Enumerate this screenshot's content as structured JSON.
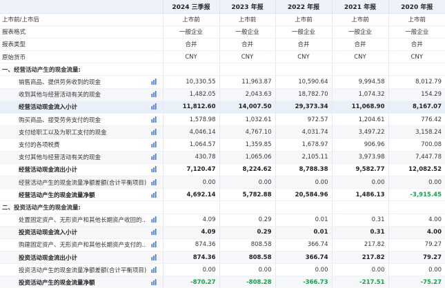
{
  "columns": [
    "2024 三季报",
    "2023 年报",
    "2022 年报",
    "2021 年报",
    "2020 年报"
  ],
  "rows": [
    {
      "type": "meta",
      "label": "上市前/上市后",
      "values": [
        "上市前",
        "上市前",
        "上市前",
        "上市前",
        "上市前"
      ]
    },
    {
      "type": "meta",
      "label": "报表格式",
      "values": [
        "一般企业",
        "一般企业",
        "一般企业",
        "一般企业",
        "一般企业"
      ]
    },
    {
      "type": "meta",
      "label": "报表类型",
      "values": [
        "合并",
        "合并",
        "合并",
        "合并",
        "合并"
      ]
    },
    {
      "type": "meta",
      "label": "原始货币",
      "values": [
        "CNY",
        "CNY",
        "CNY",
        "CNY",
        "CNY"
      ]
    },
    {
      "type": "section",
      "label": "一、经营活动产生的现金流量:",
      "values": [
        "",
        "",
        "",
        "",
        ""
      ]
    },
    {
      "type": "item",
      "label": "销售商品、提供劳务收到的现金",
      "values": [
        "10,330.55",
        "11,963.87",
        "10,590.64",
        "9,994.58",
        "8,012.79"
      ]
    },
    {
      "type": "item",
      "label": "收到其他与经营活动有关的现金",
      "values": [
        "1,482.05",
        "2,043.63",
        "18,782.70",
        "1,074.32",
        "154.29"
      ]
    },
    {
      "type": "subtotal",
      "label": "经营活动现金流入小计",
      "values": [
        "11,812.60",
        "14,007.50",
        "29,373.34",
        "11,068.90",
        "8,167.07"
      ]
    },
    {
      "type": "item",
      "label": "购买商品、接受劳务支付的现金",
      "values": [
        "1,578.98",
        "1,032.61",
        "972.57",
        "1,204.61",
        "776.42"
      ]
    },
    {
      "type": "item",
      "label": "支付给职工以及为职工支付的现金",
      "values": [
        "4,046.14",
        "4,767.10",
        "4,031.74",
        "3,497.22",
        "3,158.24"
      ]
    },
    {
      "type": "item",
      "label": "支付的各项税费",
      "values": [
        "1,064.57",
        "1,359.85",
        "1,678.97",
        "906.96",
        "700.08"
      ]
    },
    {
      "type": "item",
      "label": "支付其他与经营活动有关的现金",
      "values": [
        "430.78",
        "1,065.06",
        "2,105.11",
        "3,973.98",
        "7,447.78"
      ]
    },
    {
      "type": "bold",
      "label": "经营活动现金流出小计",
      "values": [
        "7,120.47",
        "8,224.62",
        "8,788.38",
        "9,582.77",
        "12,082.52"
      ]
    },
    {
      "type": "item",
      "label": "经营活动产生的现金流量净额差额(合计平衡项目)",
      "values": [
        "0.00",
        "0.00",
        "0.00",
        "0.00",
        "0.00"
      ]
    },
    {
      "type": "bold",
      "label": "经营活动产生的现金流量净额",
      "values": [
        "4,692.14",
        "5,782.88",
        "20,584.96",
        "1,486.13",
        "-3,915.45"
      ]
    },
    {
      "type": "section",
      "label": "二、投资活动产生的现金流量:",
      "values": [
        "",
        "",
        "",
        "",
        ""
      ]
    },
    {
      "type": "item",
      "label": "处置固定资产、无形资产和其他长期资产收回的...",
      "values": [
        "4.09",
        "0.29",
        "0.01",
        "0.31",
        "4.00"
      ]
    },
    {
      "type": "bold",
      "label": "投资活动现金流入小计",
      "values": [
        "4.09",
        "0.29",
        "0.01",
        "0.31",
        "4.00"
      ]
    },
    {
      "type": "item",
      "label": "购建固定资产、无形资产和其他长期资产支付的...",
      "values": [
        "874.36",
        "808.58",
        "366.74",
        "217.82",
        "79.27"
      ]
    },
    {
      "type": "bold",
      "label": "投资活动现金流出小计",
      "values": [
        "874.36",
        "808.58",
        "366.74",
        "217.82",
        "79.27"
      ]
    },
    {
      "type": "item",
      "label": "投资活动产生的现金流量净额差额(合计平衡项目)",
      "values": [
        "0.00",
        "0.00",
        "0.00",
        "0.00",
        "0.00"
      ]
    },
    {
      "type": "bold",
      "label": "投资活动产生的现金流量净额",
      "values": [
        "-870.27",
        "-808.28",
        "-366.73",
        "-217.51",
        "-75.27"
      ]
    }
  ],
  "colors": {
    "negative": "#11a34a",
    "header_bg": "#eef3fb",
    "subtotal_bg": "#eaf0fa",
    "icon": "#3d6fd8"
  },
  "icon_name": "bar-chart-icon"
}
